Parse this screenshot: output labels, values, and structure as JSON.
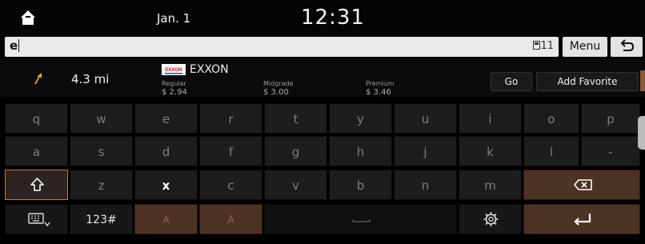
{
  "status_bar": {
    "date": "Jan. 1",
    "time": "12:31"
  },
  "search": {
    "value": "e",
    "char_count": "11",
    "menu_label": "Menu"
  },
  "poi": {
    "distance": "4.3 mi",
    "brand": "EXXON",
    "logo_text": "EXXON",
    "fuel": [
      {
        "label": "Regular",
        "price": "$ 2.94"
      },
      {
        "label": "Midgrade",
        "price": "$ 3.00"
      },
      {
        "label": "Premium",
        "price": "$ 3.46"
      }
    ],
    "go_label": "Go",
    "favorite_label": "Add Favorite"
  },
  "keyboard": {
    "row1": [
      "q",
      "w",
      "e",
      "r",
      "t",
      "y",
      "u",
      "i",
      "o",
      "p"
    ],
    "row2": [
      "a",
      "s",
      "d",
      "f",
      "g",
      "h",
      "j",
      "k",
      "l",
      "-"
    ],
    "row3": [
      "z",
      "x",
      "c",
      "v",
      "b",
      "n",
      "m"
    ],
    "numbers_label": "123#",
    "accent_a": "A",
    "accent_a_grave": "À"
  },
  "colors": {
    "accent": "#c4763e",
    "input_bg": "#e9e9e9"
  }
}
